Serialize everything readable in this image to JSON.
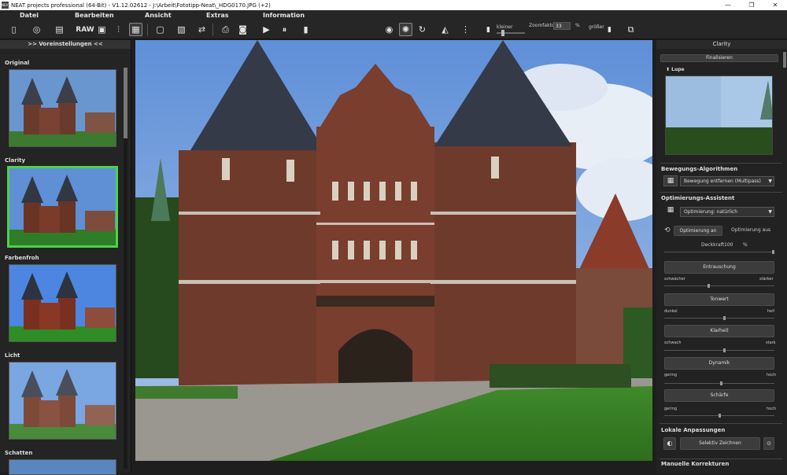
{
  "window": {
    "title": "NEAT projects professional (64-Bit) - V1.12.02612 - J:\\Arbeit\\Fototipp-Neat\\_HDG0170.JPG (+2)",
    "app_icon": "NEAT",
    "minimize": "—",
    "maximize": "❐",
    "close": "✕"
  },
  "menu": {
    "datei": "Datei",
    "bearbeiten": "Bearbeiten",
    "ansicht": "Ansicht",
    "extras": "Extras",
    "information": "Information"
  },
  "toolbar": {
    "raw_label": "RAW",
    "zoom_smaller": "kleiner",
    "zoom_label": "Zoomfaktor",
    "zoom_value": "33",
    "zoom_unit": "%",
    "zoom_larger": "größer"
  },
  "left_panel": {
    "header": ">> Voreinstellungen <<",
    "presets": [
      {
        "name": "Original"
      },
      {
        "name": "Clarity"
      },
      {
        "name": "Farbenfroh"
      },
      {
        "name": "Licht"
      },
      {
        "name": "Schatten"
      }
    ]
  },
  "right_panel": {
    "title": "Clarity",
    "finalize": "Finalisieren",
    "lupe": "Lupe",
    "motion_section": "Bewegungs-Algorithmen",
    "motion_select": "Bewegung entfernen (Multipass)",
    "opt_section": "Optimierungs-Assistent",
    "opt_select": "Optimierung: natürlich",
    "opt_on": "Optimierung an",
    "opt_off": "Optimierung aus",
    "deckkraft_label": "Deckkraft",
    "deckkraft_value": "100",
    "deckkraft_unit": "%",
    "entrauschung": "Entrauschung",
    "ent_min": "schwächer",
    "ent_max": "stärker",
    "tonwert": "Tonwert",
    "ton_min": "dunkel",
    "ton_max": "hell",
    "klarheit": "Klarheit",
    "kla_min": "schwach",
    "kla_max": "stark",
    "dynamik": "Dynamik",
    "dyn_min": "gering",
    "dyn_max": "hoch",
    "schaerfe": "Schärfe",
    "sch_min": "gering",
    "sch_max": "hoch",
    "local_section": "Lokale Anpassungen",
    "selective": "Selektiv Zeichnen",
    "manual_section": "Manuelle Korrekturen"
  },
  "sliders": {
    "deckkraft": 1.0,
    "entrauschung": 0.4,
    "tonwert": 0.55,
    "klarheit": 0.55,
    "dynamik": 0.52,
    "schaerfe": 0.5
  },
  "icons": {
    "save": "💾",
    "play": "▶",
    "eye": "👁",
    "rotate": "↻"
  }
}
